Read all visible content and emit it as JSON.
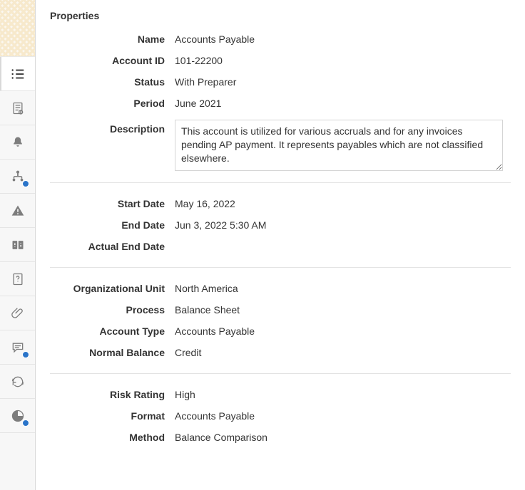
{
  "panel_title": "Properties",
  "sections": {
    "basic": {
      "name_label": "Name",
      "name_value": "Accounts Payable",
      "account_id_label": "Account ID",
      "account_id_value": "101-22200",
      "status_label": "Status",
      "status_value": "With Preparer",
      "period_label": "Period",
      "period_value": "June 2021",
      "description_label": "Description",
      "description_value": "This account is utilized for various accruals and for any invoices pending AP payment. It represents payables which are not classified elsewhere."
    },
    "dates": {
      "start_date_label": "Start Date",
      "start_date_value": "May 16, 2022",
      "end_date_label": "End Date",
      "end_date_value": "Jun 3, 2022 5:30 AM",
      "actual_end_date_label": "Actual End Date",
      "actual_end_date_value": ""
    },
    "org": {
      "org_unit_label": "Organizational Unit",
      "org_unit_value": "North America",
      "process_label": "Process",
      "process_value": "Balance Sheet",
      "account_type_label": "Account Type",
      "account_type_value": "Accounts Payable",
      "normal_balance_label": "Normal Balance",
      "normal_balance_value": "Credit"
    },
    "risk": {
      "risk_rating_label": "Risk Rating",
      "risk_rating_value": "High",
      "format_label": "Format",
      "format_value": "Accounts Payable",
      "method_label": "Method",
      "method_value": "Balance Comparison"
    }
  }
}
